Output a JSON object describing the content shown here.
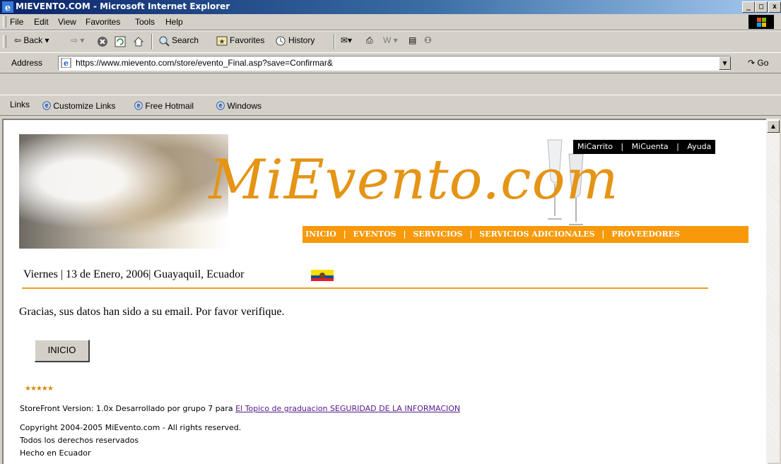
{
  "window": {
    "title": "MIEVENTO.COM - Microsoft Internet Explorer",
    "buttons": [
      "_",
      "□",
      "x"
    ]
  },
  "menu": [
    "File",
    "Edit",
    "View",
    "Favorites",
    "Tools",
    "Help"
  ],
  "toolbar": {
    "back": "Back",
    "search": "Search",
    "favorites": "Favorites",
    "history": "History"
  },
  "address": {
    "label": "Address",
    "url": "https://www.mievento.com/store/evento_Final.asp?save=Confirmar&",
    "go": "Go"
  },
  "links": {
    "label": "Links",
    "items": [
      "Customize Links",
      "Free Hotmail",
      "Windows"
    ]
  },
  "site": {
    "logo": "MiEvento.com",
    "top_nav": [
      "MiCarrito",
      "MiCuenta",
      "Ayuda"
    ],
    "top_nav_sep": "|",
    "main_nav": [
      "INICIO",
      "EVENTOS",
      "SERVICIOS",
      "SERVICIOS ADICIONALES",
      "PROVEEDORES"
    ],
    "main_nav_sep": "|",
    "dateline": "Viernes | 13 de Enero, 2006| Guayaquil, Ecuador",
    "message": "Gracias, sus datos han sido a su email. Por favor verifique.",
    "inicio_button": "INICIO",
    "stars": "★★★★★",
    "footer": {
      "storefront_prefix": "StoreFront Version: 1.0x Desarrollado por grupo 7 para",
      "storefront_link": "El Topico de graduacion SEGURIDAD DE LA INFORMACION",
      "copyright": "Copyright 2004-2005 MiEvento.com - All rights reserved.",
      "rights": "Todos los derechos reservados",
      "made_in": "Hecho en Ecuador"
    }
  },
  "colors": {
    "accent": "#f7990b",
    "logo": "#e59416",
    "titlebar": "#0a246a",
    "link_visited": "#551a8b"
  }
}
